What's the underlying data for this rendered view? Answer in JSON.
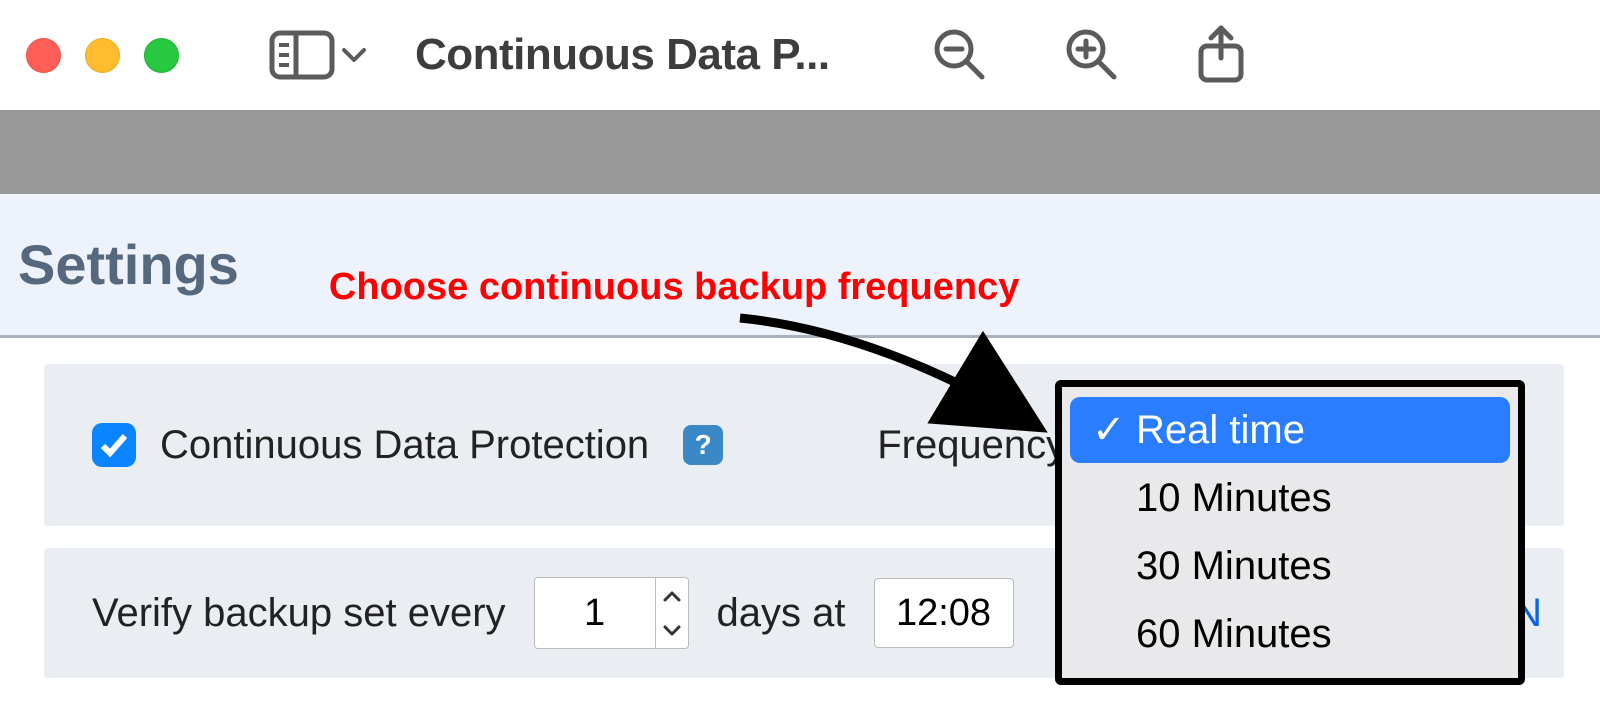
{
  "window": {
    "title": "Continuous Data P..."
  },
  "settings": {
    "heading": "Settings",
    "annotation": "Choose continuous backup frequency"
  },
  "cdp": {
    "checkbox_label": "Continuous Data Protection",
    "help_glyph": "?",
    "frequency_label": "Frequency"
  },
  "frequency_dropdown": {
    "selected": "Real time",
    "options": [
      "Real time",
      "10 Minutes",
      "30 Minutes",
      "60 Minutes"
    ]
  },
  "verify": {
    "prefix": "Verify backup set every",
    "days_value": "1",
    "days_word": "days at",
    "time_value": "12:08",
    "link_fragment": "y N"
  },
  "icons": {
    "sidebar": "sidebar-toggle-icon",
    "chevron_down": "chevron-down-icon",
    "zoom_out": "zoom-out-icon",
    "zoom_in": "zoom-in-icon",
    "share": "share-icon"
  }
}
